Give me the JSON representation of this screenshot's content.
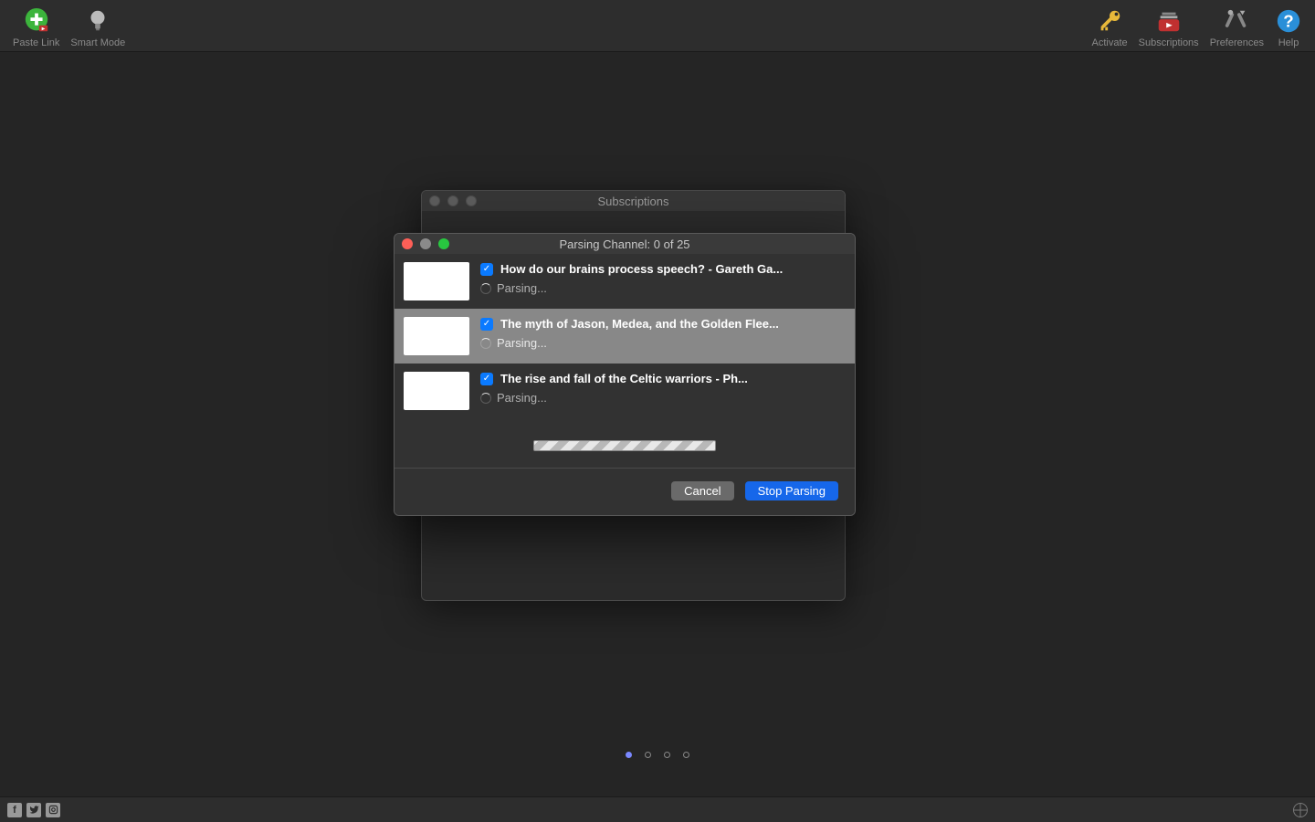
{
  "toolbar": {
    "left": [
      {
        "id": "paste-link",
        "label": "Paste Link"
      },
      {
        "id": "smart-mode",
        "label": "Smart Mode"
      }
    ],
    "right": [
      {
        "id": "activate",
        "label": "Activate"
      },
      {
        "id": "subscriptions",
        "label": "Subscriptions"
      },
      {
        "id": "preferences",
        "label": "Preferences"
      },
      {
        "id": "help",
        "label": "Help"
      }
    ]
  },
  "subs_window": {
    "title": "Subscriptions"
  },
  "modal": {
    "title": "Parsing Channel: 0 of 25",
    "items": [
      {
        "title": "How do our brains process speech? - Gareth Ga...",
        "status": "Parsing...",
        "checked": true,
        "highlighted": false
      },
      {
        "title": "The myth of Jason, Medea, and the Golden Flee...",
        "status": "Parsing...",
        "checked": true,
        "highlighted": true
      },
      {
        "title": "The rise and fall of the Celtic warriors - Ph...",
        "status": "Parsing...",
        "checked": true,
        "highlighted": false
      }
    ],
    "cancel_label": "Cancel",
    "stop_label": "Stop Parsing"
  },
  "page_indicator": {
    "count": 4,
    "active": 0
  }
}
